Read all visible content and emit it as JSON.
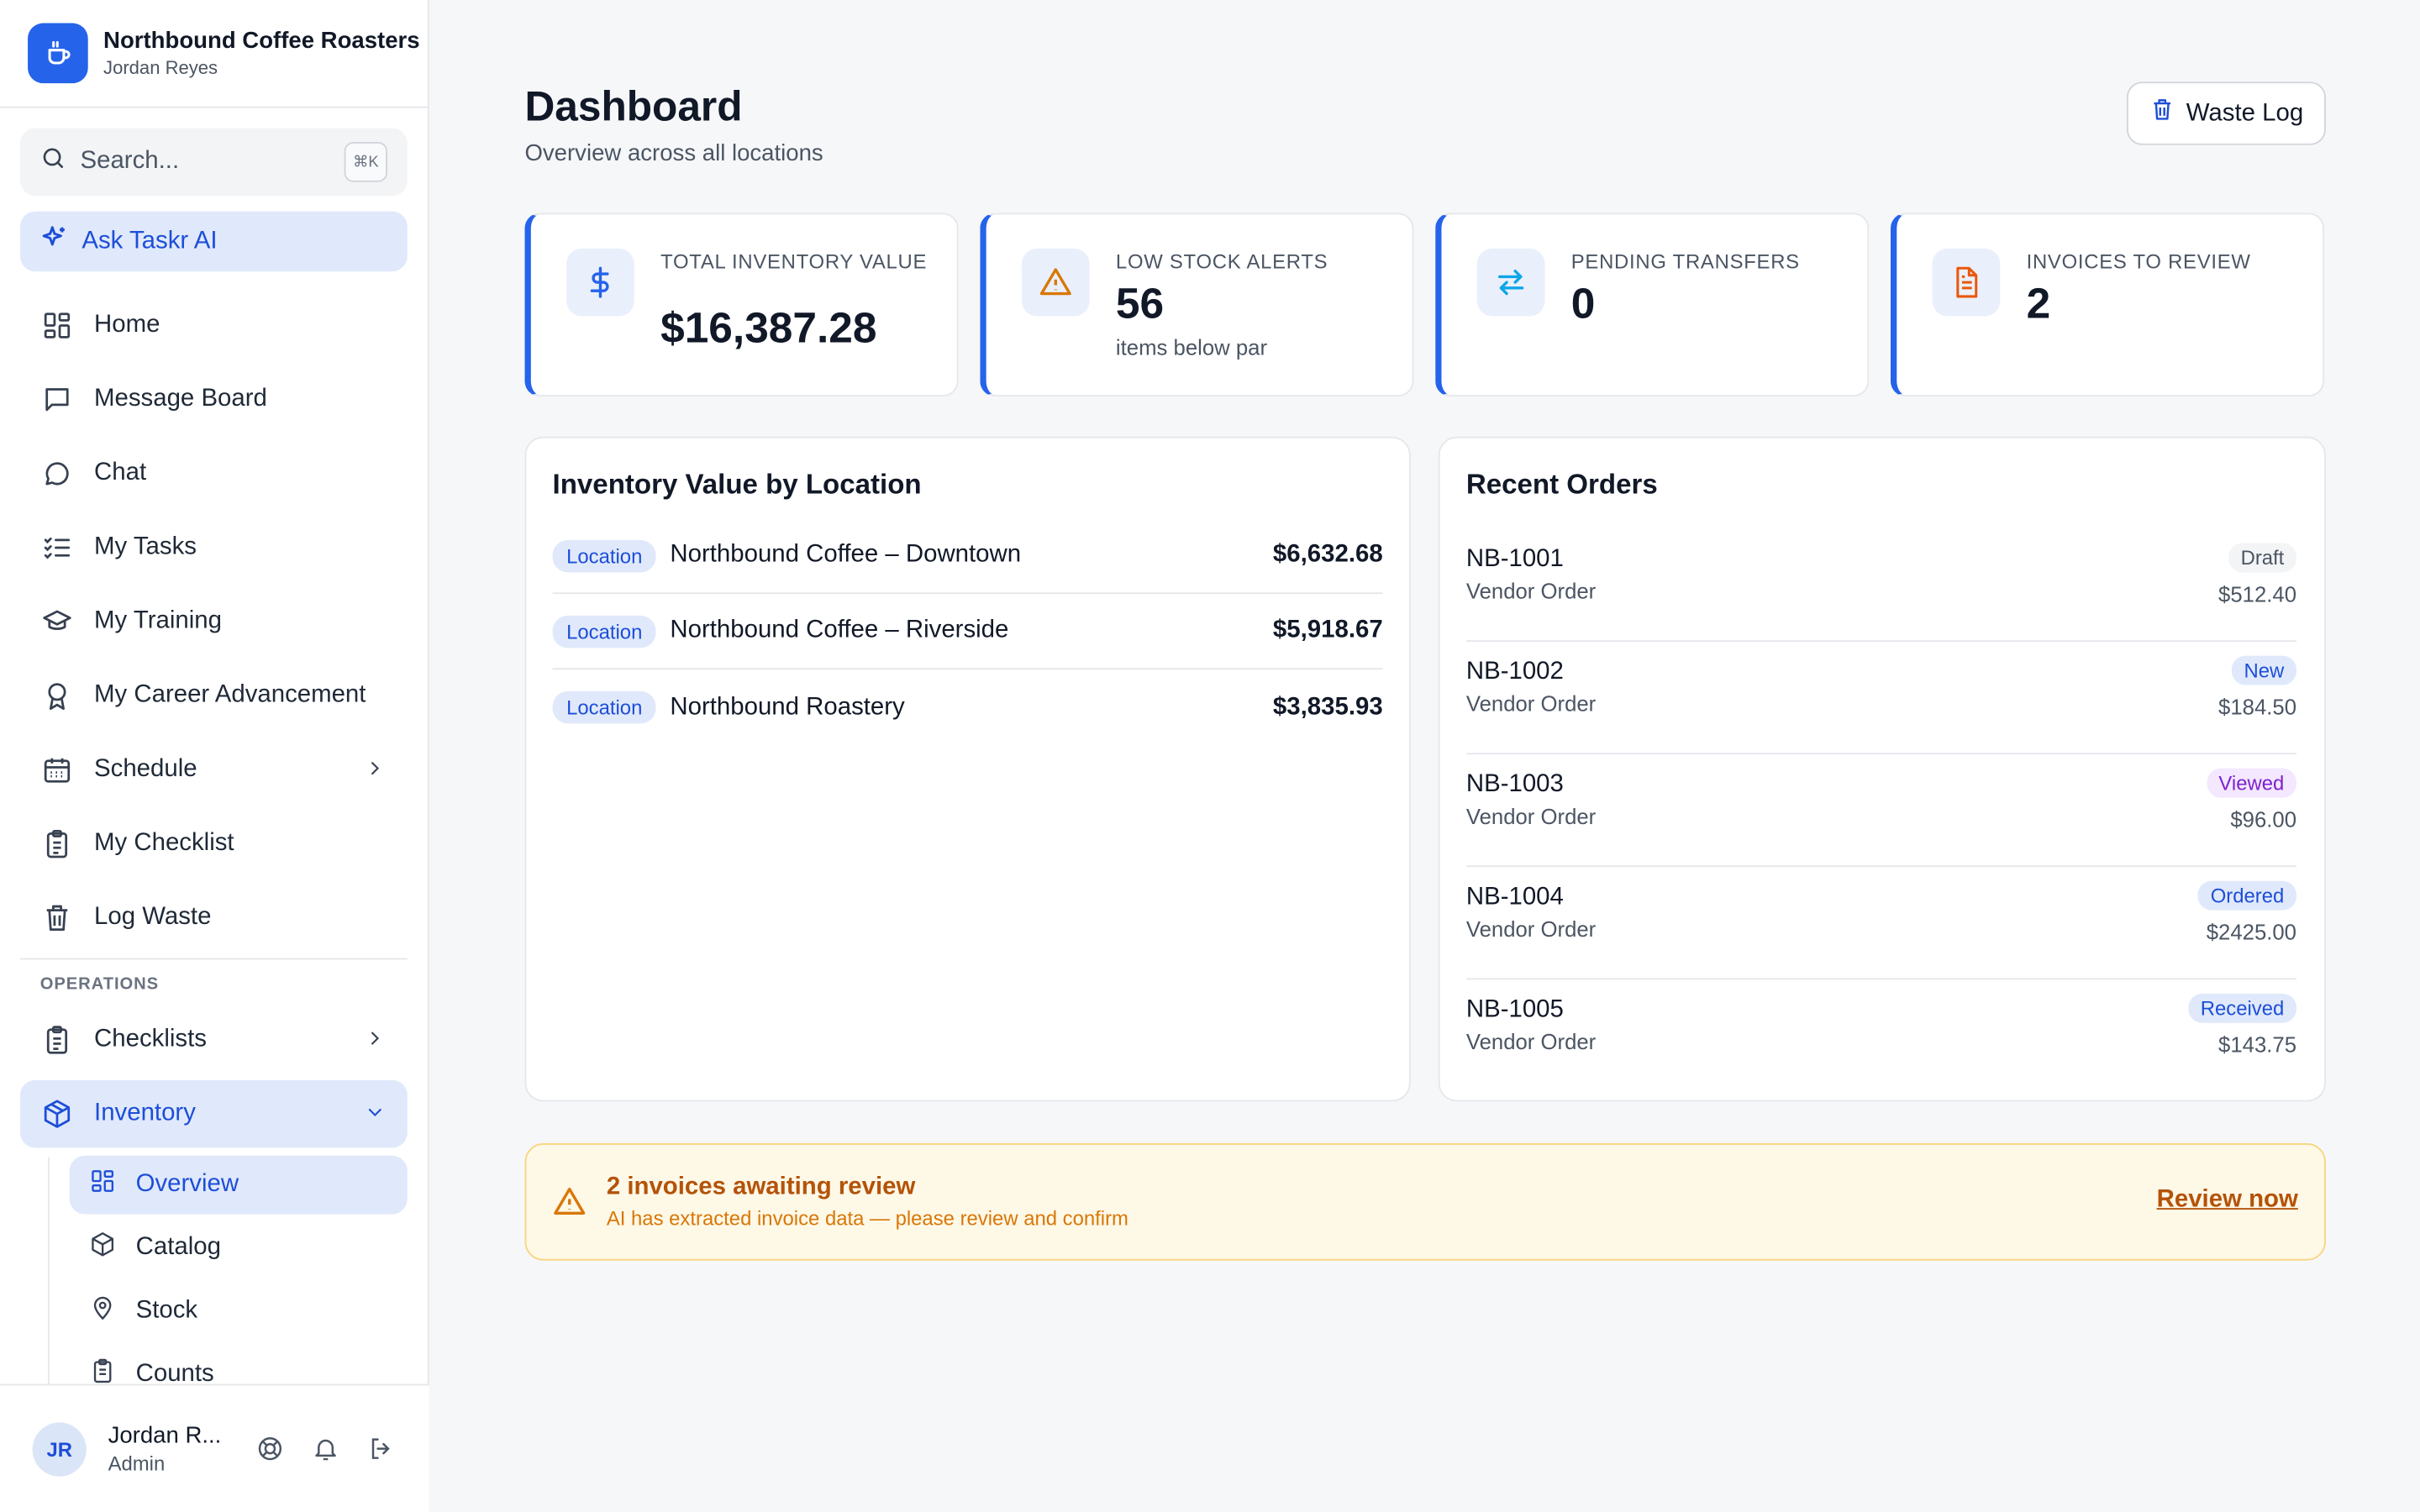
{
  "brand": {
    "name": "Northbound Coffee Roasters",
    "user": "Jordan Reyes"
  },
  "search": {
    "placeholder": "Search...",
    "shortcut": "⌘K"
  },
  "ask_ai": {
    "label": "Ask Taskr AI"
  },
  "nav": {
    "items": [
      {
        "label": "Home",
        "icon": "grid-icon"
      },
      {
        "label": "Message Board",
        "icon": "message-square-icon"
      },
      {
        "label": "Chat",
        "icon": "chat-bubble-icon"
      },
      {
        "label": "My Tasks",
        "icon": "task-list-icon"
      },
      {
        "label": "My Training",
        "icon": "graduation-cap-icon"
      },
      {
        "label": "My Career Advancement",
        "icon": "award-icon"
      },
      {
        "label": "Schedule",
        "icon": "calendar-icon"
      },
      {
        "label": "My Checklist",
        "icon": "clipboard-icon"
      },
      {
        "label": "Log Waste",
        "icon": "trash-icon"
      }
    ],
    "section_label": "OPERATIONS",
    "ops": [
      {
        "label": "Checklists",
        "icon": "clipboard-icon"
      },
      {
        "label": "Inventory",
        "icon": "package-icon"
      }
    ],
    "inventory_sub": [
      {
        "label": "Overview",
        "icon": "grid-icon"
      },
      {
        "label": "Catalog",
        "icon": "box-icon"
      },
      {
        "label": "Stock",
        "icon": "map-pin-icon"
      },
      {
        "label": "Counts",
        "icon": "clipboard-icon"
      }
    ]
  },
  "user": {
    "initials": "JR",
    "name": "Jordan R...",
    "role": "Admin"
  },
  "page": {
    "title": "Dashboard",
    "subtitle": "Overview across all locations",
    "waste_button": "Waste Log"
  },
  "stats": [
    {
      "label": "TOTAL INVENTORY VALUE",
      "value": "$16,387.28",
      "note": "",
      "icon": "dollar-icon"
    },
    {
      "label": "LOW STOCK ALERTS",
      "value": "56",
      "note": "items below par",
      "icon": "warning-icon"
    },
    {
      "label": "PENDING TRANSFERS",
      "value": "0",
      "note": "",
      "icon": "transfer-arrows-icon"
    },
    {
      "label": "INVOICES TO REVIEW",
      "value": "2",
      "note": "",
      "icon": "document-icon"
    }
  ],
  "locations": {
    "title": "Inventory Value by Location",
    "tag": "Location",
    "rows": [
      {
        "name": "Northbound Coffee – Downtown",
        "value": "$6,632.68"
      },
      {
        "name": "Northbound Coffee – Riverside",
        "value": "$5,918.67"
      },
      {
        "name": "Northbound Roastery",
        "value": "$3,835.93"
      }
    ]
  },
  "orders": {
    "title": "Recent Orders",
    "rows": [
      {
        "id": "NB-1001",
        "type": "Vendor Order",
        "status": "Draft",
        "amount": "$512.40",
        "status_bg": "#f3f4f6",
        "status_color": "#4b5563"
      },
      {
        "id": "NB-1002",
        "type": "Vendor Order",
        "status": "New",
        "amount": "$184.50",
        "status_bg": "#e0e9fb",
        "status_color": "#1d4ed8"
      },
      {
        "id": "NB-1003",
        "type": "Vendor Order",
        "status": "Viewed",
        "amount": "$96.00",
        "status_bg": "#f3e8ff",
        "status_color": "#7e22ce"
      },
      {
        "id": "NB-1004",
        "type": "Vendor Order",
        "status": "Ordered",
        "amount": "$2425.00",
        "status_bg": "#e0e9fb",
        "status_color": "#1d4ed8"
      },
      {
        "id": "NB-1005",
        "type": "Vendor Order",
        "status": "Received",
        "amount": "$143.75",
        "status_bg": "#e0e9fb",
        "status_color": "#1d4ed8"
      }
    ]
  },
  "alert": {
    "title": "2 invoices awaiting review",
    "subtitle": "AI has extracted invoice data — please review and confirm",
    "link": "Review now"
  },
  "colors": {
    "accent": "#2563eb",
    "warning": "#b45309",
    "alert_bg": "#fef8e7"
  }
}
